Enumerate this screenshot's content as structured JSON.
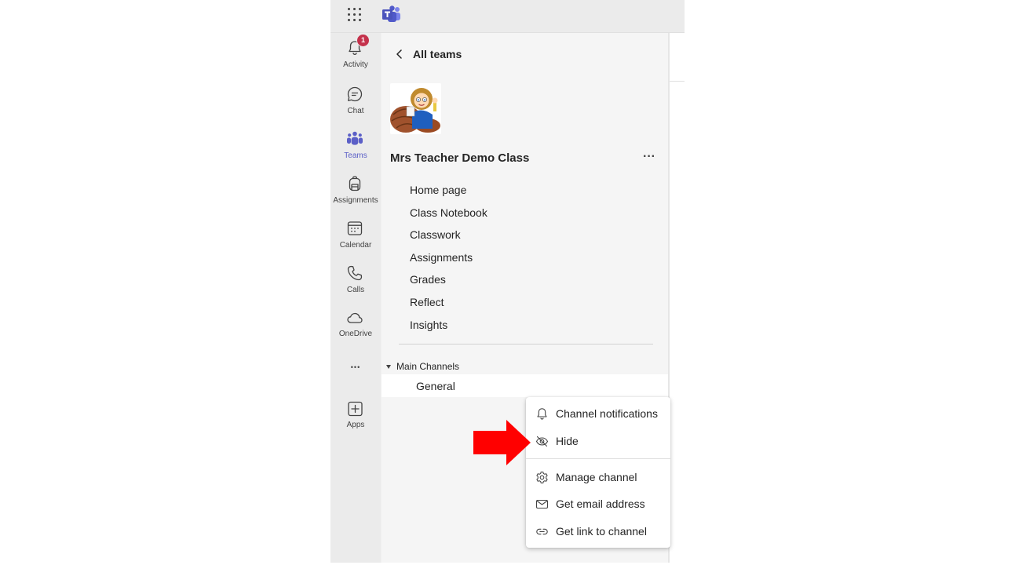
{
  "topbar": {
    "waffle_icon": "app-launcher-icon",
    "logo_icon": "teams-logo-icon"
  },
  "rail": {
    "items": [
      {
        "label": "Activity",
        "icon": "bell-icon",
        "badge": "1"
      },
      {
        "label": "Chat",
        "icon": "chat-icon"
      },
      {
        "label": "Teams",
        "icon": "teams-icon",
        "active": true
      },
      {
        "label": "Assignments",
        "icon": "backpack-icon"
      },
      {
        "label": "Calendar",
        "icon": "calendar-icon"
      },
      {
        "label": "Calls",
        "icon": "phone-icon"
      },
      {
        "label": "OneDrive",
        "icon": "cloud-icon"
      },
      {
        "label": "Apps",
        "icon": "add-app-icon"
      }
    ],
    "more_label": "•••"
  },
  "panel": {
    "back_label": "All teams",
    "team_name": "Mrs Teacher Demo Class",
    "more_label": "···",
    "nav": [
      "Home page",
      "Class Notebook",
      "Classwork",
      "Assignments",
      "Grades",
      "Reflect",
      "Insights"
    ],
    "section_label": "Main Channels",
    "channel": "General"
  },
  "context_menu": {
    "items": [
      {
        "label": "Channel notifications",
        "icon": "bell-icon"
      },
      {
        "label": "Hide",
        "icon": "eye-off-icon"
      },
      {
        "label": "Manage channel",
        "icon": "gear-icon"
      },
      {
        "label": "Get email address",
        "icon": "mail-icon"
      },
      {
        "label": "Get link to channel",
        "icon": "link-icon"
      }
    ]
  },
  "colors": {
    "accent": "#5b5fc7",
    "badge": "#c4314b",
    "arrow": "#ff0000"
  }
}
